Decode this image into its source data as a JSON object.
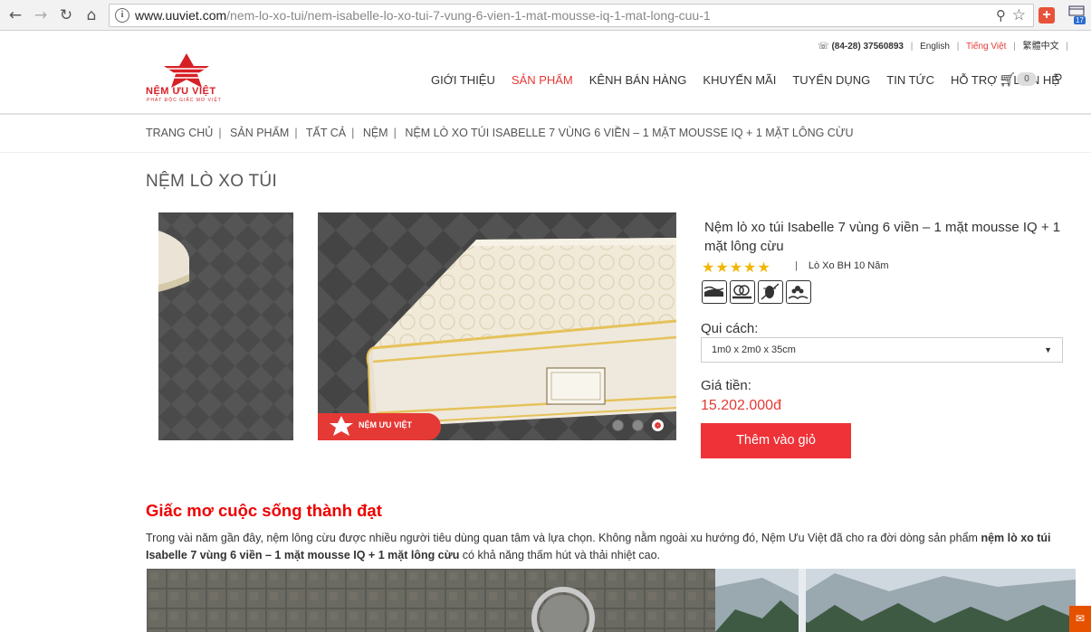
{
  "browser": {
    "url_main": "www.uuviet.com",
    "url_path": "/nem-lo-xo-tui/nem-isabelle-lo-xo-tui-7-vung-6-vien-1-mat-mousse-iq-1-mat-long-cuu-1",
    "ext_badge": "17"
  },
  "topbar": {
    "phone": "(84-28) 37560893",
    "lang_en": "English",
    "lang_vi": "Tiếng Việt",
    "lang_zh": "繁體中文"
  },
  "logo": {
    "brand": "NỆM ƯU VIỆT",
    "tagline": "PHÁT ĐỘC GIẤC MƠ VIỆT"
  },
  "nav": {
    "items": [
      "GIỚI THIỆU",
      "SẢN PHẨM",
      "KÊNH BÁN HÀNG",
      "KHUYẾN MÃI",
      "TUYỂN DỤNG",
      "TIN TỨC",
      "HỖ TRỢ",
      "LIÊN HỆ"
    ],
    "cart_count": "0"
  },
  "breadcrumb": [
    "TRANG CHỦ",
    "SẢN PHẨM",
    "TẤT CẢ",
    "NỆM",
    "NỆM LÒ XO TÚI ISABELLE 7 VÙNG 6 VIỀN – 1 MẶT MOUSSE IQ + 1 MẶT LÔNG CỪU"
  ],
  "category_title": "NỆM LÒ XO TÚI",
  "gallery": {
    "watermark": "NỆM ƯU VIỆT"
  },
  "product": {
    "title": "Nệm lò xo túi Isabelle 7 vùng 6 viền – 1 mặt mousse IQ + 1 mặt lông cừu",
    "rating": 5,
    "warranty": "Lò Xo BH 10 Năm",
    "spec_label": "Qui cách:",
    "spec_value": "1m0 x 2m0 x 35cm",
    "price_label": "Giá tiền:",
    "price": "15.202.000đ",
    "add_to_cart": "Thêm vào giỏ"
  },
  "content": {
    "heading": "Giấc mơ cuộc sống thành đạt",
    "para_1": "Trong vài năm gần đây, nệm lông cừu được nhiều người tiêu dùng quan tâm và lựa chọn. Không nằm ngoài xu hướng đó, Nệm Ưu Việt đã cho ra đời dòng sản phẩm ",
    "para_bold": "nệm lò xo túi Isabelle 7 vùng 6 viền – 1 mặt mousse IQ + 1 mặt lông cừu",
    "para_2": " có khả năng thấm hút và thải nhiệt cao."
  },
  "colors": {
    "accent": "#e53935",
    "button": "#ee3237",
    "heading_red": "#e00000",
    "star": "#f2b705"
  }
}
